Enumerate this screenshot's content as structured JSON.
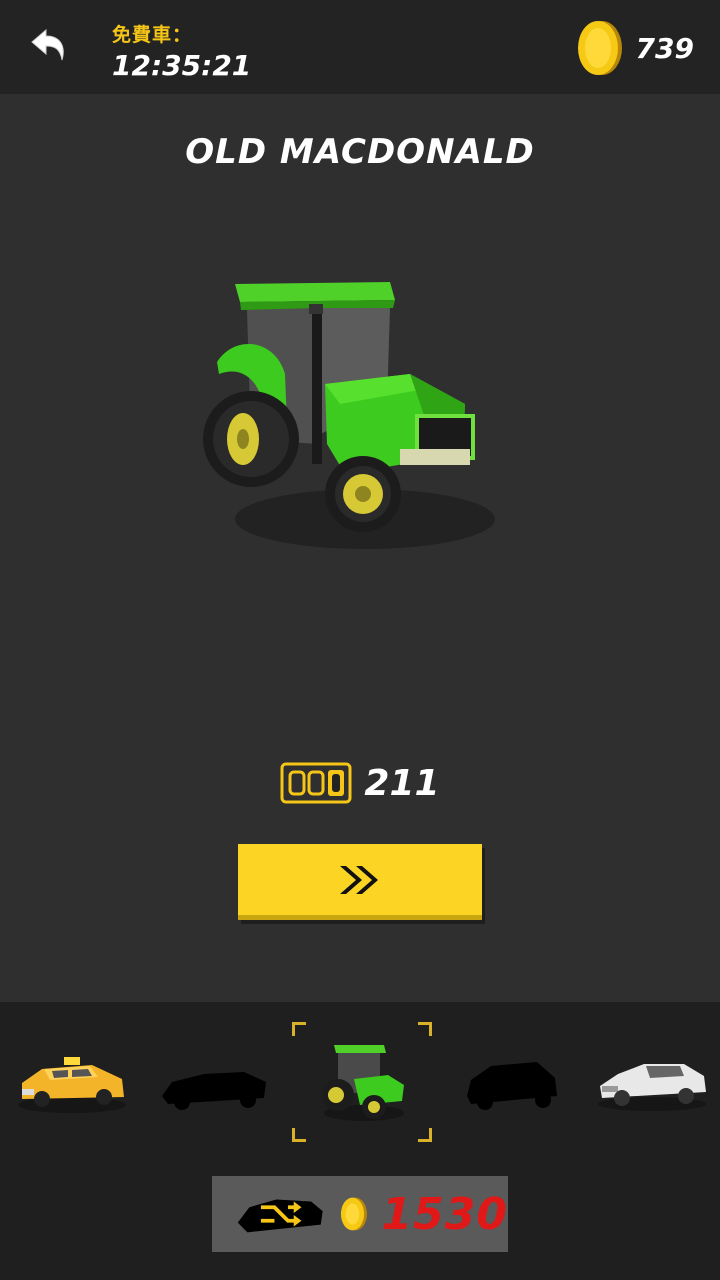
{
  "header": {
    "free_car_label": "免費車：",
    "free_car_timer": "12:35:21",
    "coin_balance": "739",
    "back_icon": "back-arrow-icon",
    "coin_icon": "gold-coin-icon"
  },
  "car": {
    "name": "OLD MACDONALD",
    "distance": "211"
  },
  "next_button_icon": "double-chevron-right-icon",
  "selector": {
    "cars": [
      {
        "name": "taxi",
        "state": "unlocked"
      },
      {
        "name": "sports-car",
        "state": "locked"
      },
      {
        "name": "tractor",
        "state": "selected"
      },
      {
        "name": "hatchback",
        "state": "locked"
      },
      {
        "name": "white-coupe",
        "state": "unlocked"
      }
    ]
  },
  "random_unlock": {
    "price": "1530",
    "icon": "shuffle-icon"
  },
  "colors": {
    "accent": "#fbd424",
    "price_red": "#e01818",
    "tractor_green": "#3ecb1f"
  }
}
